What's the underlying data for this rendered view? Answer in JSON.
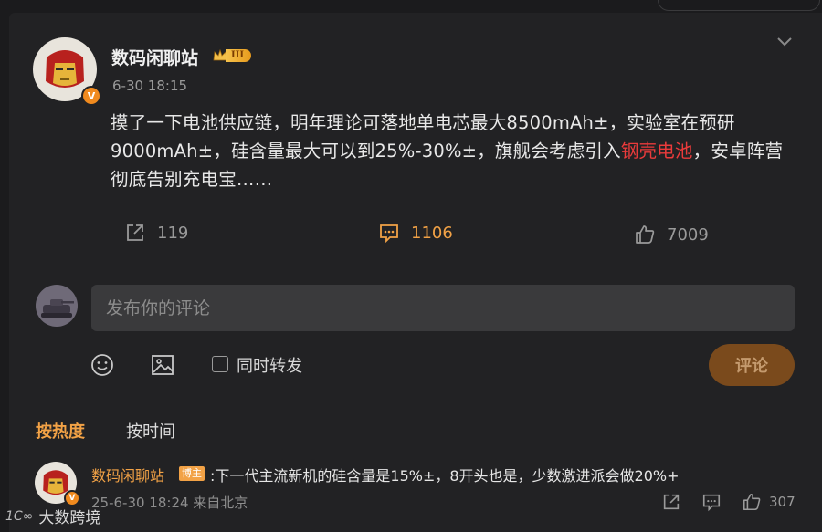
{
  "post": {
    "author": "数码闲聊站",
    "level_badge": "III",
    "verified_badge": "V",
    "time": "6-30 18:15",
    "text_before": "摸了一下电池供应链，明年理论可落地单电芯最大8500mAh±，实验室在预研9000mAh±，硅含量最大可以到25%-30%±，旗舰会考虑引入",
    "text_highlight": "钢壳电池",
    "text_after": "，安卓阵营彻底告别充电宝……",
    "repost_count": "119",
    "comment_count": "1106",
    "like_count": "7009"
  },
  "composer": {
    "placeholder": "发布你的评论",
    "repost_label": "同时转发",
    "submit_label": "评论"
  },
  "sort": {
    "hot": "按热度",
    "time": "按时间"
  },
  "comments": [
    {
      "author": "数码闲聊站",
      "role_badge": "博主",
      "text": ":下一代主流新机的硅含量是15%±，8开头也是，少数激进派会做20%+",
      "meta": "25-6-30 18:24 来自北京",
      "likes": "307"
    }
  ],
  "watermark": {
    "logo": "1C∞",
    "text": "大数跨境"
  },
  "colors": {
    "background": "#1b1b1d",
    "card": "#222224",
    "accent": "#f2a246",
    "highlight": "#eb3b3b",
    "submit_bg": "#7a4a1c"
  }
}
